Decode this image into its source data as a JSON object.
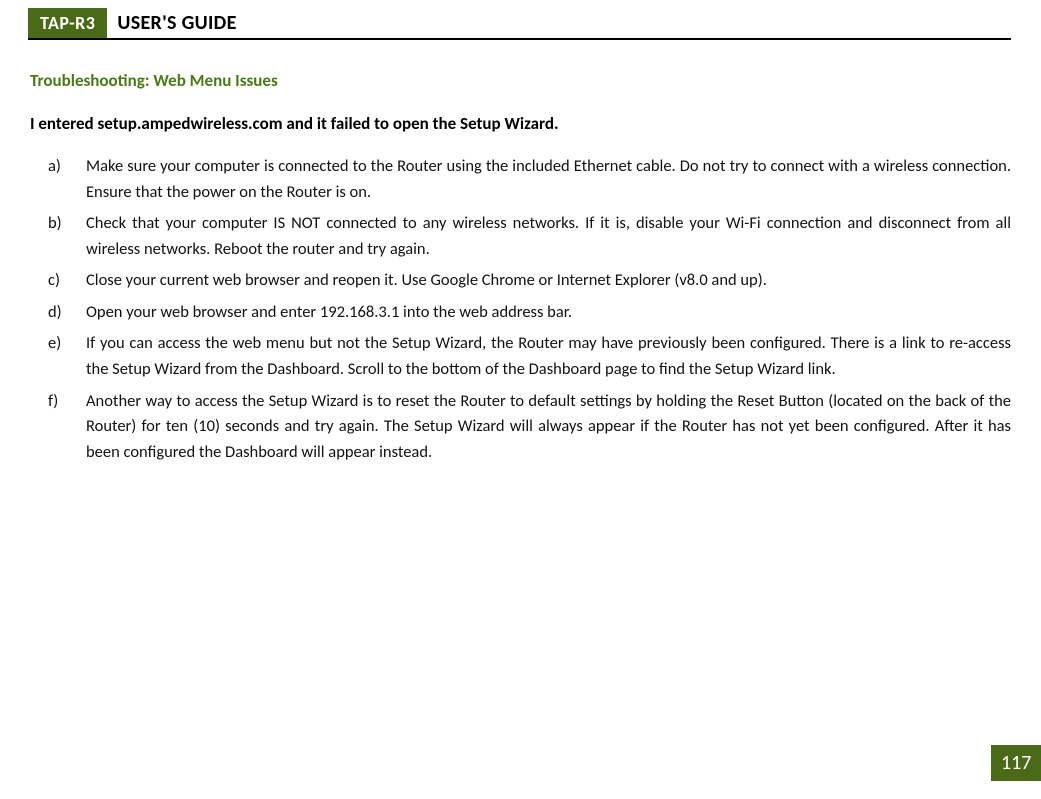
{
  "header": {
    "badge": "TAP-R3",
    "title": "USER'S GUIDE"
  },
  "section_title": "Troubleshooting: Web Menu Issues",
  "question": "I entered setup.ampedwireless.com and it failed to open the Setup Wizard.",
  "steps": [
    {
      "marker": "a)",
      "text": "Make sure your computer is connected to the Router using the included Ethernet cable. Do not try to connect with a wireless connection. Ensure that the power on the Router is on."
    },
    {
      "marker": "b)",
      "text": "Check that your computer IS NOT connected to any wireless networks. If it is, disable your Wi-Fi connection and disconnect from all wireless networks. Reboot the router and try again."
    },
    {
      "marker": "c)",
      "text": "Close your current web browser and reopen it.  Use Google Chrome or Internet Explorer (v8.0 and up)."
    },
    {
      "marker": "d)",
      "text": "Open your web browser and enter 192.168.3.1 into the web address bar."
    },
    {
      "marker": "e)",
      "text": "If you can access the web menu but not the Setup Wizard, the Router may have previously been configured.  There is a link to re-access the Setup Wizard from the Dashboard.  Scroll to the bottom of the Dashboard page to find the Setup Wizard link."
    },
    {
      "marker": "f)",
      "text": "Another way to access the Setup Wizard is to reset the Router to default settings by holding the Reset Button (located on the back of the Router) for ten (10) seconds and try again.  The Setup Wizard will always appear if the Router has not yet been configured.  After it has been configured the Dashboard will appear instead."
    }
  ],
  "page_number": "117"
}
